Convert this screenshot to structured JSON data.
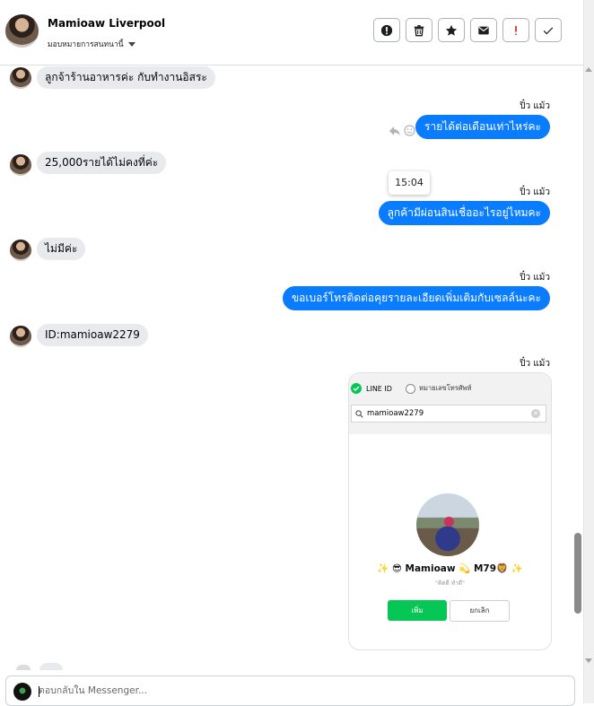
{
  "header": {
    "contact_name": "Mamioaw Liverpool",
    "assign_label": "มอบหมายการสนทนานี้",
    "tools": [
      {
        "name": "report-button",
        "icon": "alert-circle-icon"
      },
      {
        "name": "delete-button",
        "icon": "trash-icon"
      },
      {
        "name": "star-button",
        "icon": "star-icon"
      },
      {
        "name": "mark-unread-button",
        "icon": "envelope-icon"
      },
      {
        "name": "spam-button",
        "icon": "exclamation-icon"
      },
      {
        "name": "done-button",
        "icon": "check-icon"
      }
    ]
  },
  "messages": [
    {
      "direction": "in",
      "text": "ลูกจ้าร้านอาหารค่ะ กับทำงานอิสระ"
    },
    {
      "direction": "out",
      "sender": "ปิ๋ว แม้ว",
      "text": "รายได้ต่อเดือนเท่าไหร่คะ"
    },
    {
      "direction": "in",
      "text": "25,000รายได้ไม่คงที่ค่ะ"
    },
    {
      "direction": "out",
      "sender": "ปิ๋ว แม้ว",
      "text": "ลูกค้ามีผ่อนสินเชื่ออะไรอยู่ไหมคะ",
      "tooltip": "15:04"
    },
    {
      "direction": "in",
      "text": "ไม่มีค่ะ"
    },
    {
      "direction": "out",
      "sender": "ปิ๋ว แม้ว",
      "text": "ขอเบอร์โทรติดต่อคุยรายละเอียดเพิ่มเติมกับเซลล์นะคะ"
    },
    {
      "direction": "in",
      "text": "ID:mamioaw2279"
    },
    {
      "direction": "out",
      "sender": "ปิ๋ว แม้ว",
      "attachment": "line-profile-screenshot"
    }
  ],
  "line_card": {
    "option_line_id": "LINE ID",
    "option_phone": "หมายเลขโทรศัพท์",
    "search_value": "mamioaw2279",
    "profile_name": "✨ 😎 Mamioaw 💫 M79🦁 ✨",
    "profile_status": "\"คิดดี ทำดี\"",
    "add_button": "เพิ่ม",
    "cancel_button": "ยกเลิก",
    "accent_color": "#06c755"
  },
  "composer": {
    "placeholder": "ตอบกลับใน Messenger..."
  },
  "colors": {
    "outgoing_bubble": "#0a7cff",
    "incoming_bubble": "#e9eaed"
  }
}
